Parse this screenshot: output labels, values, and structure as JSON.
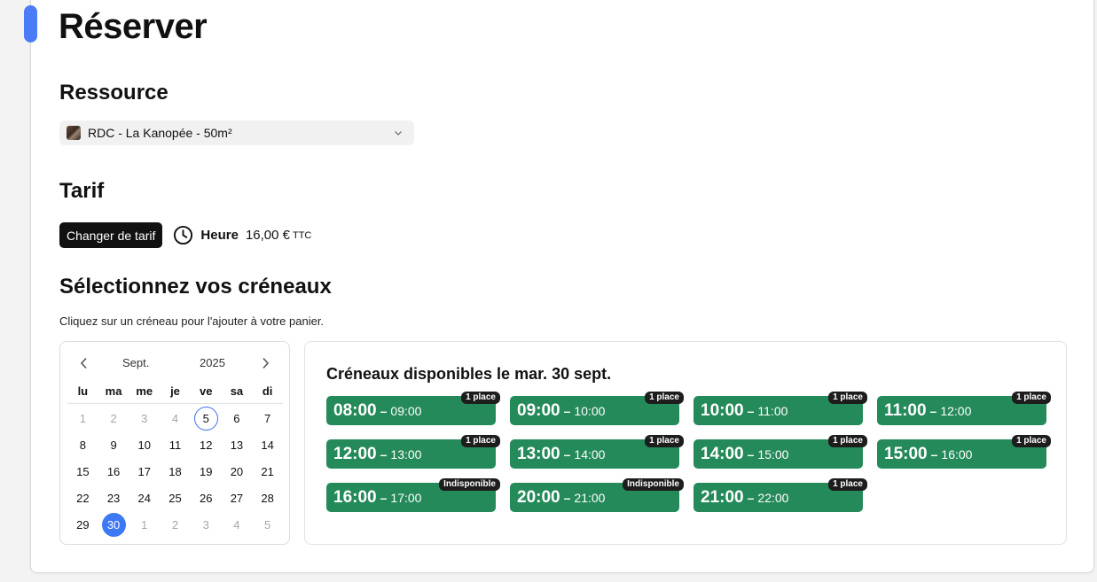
{
  "page": {
    "title": "Réserver"
  },
  "resource": {
    "heading": "Ressource",
    "selected": "RDC - La Kanopée - 50m²"
  },
  "tarif": {
    "heading": "Tarif",
    "change_button": "Changer de tarif",
    "rate_label": "Heure",
    "price": "16,00 €",
    "tax_suffix": "TTC"
  },
  "slots_section": {
    "heading": "Sélectionnez vos créneaux",
    "hint": "Cliquez sur un créneau pour l'ajouter à votre panier."
  },
  "calendar": {
    "month": "Sept.",
    "year": "2025",
    "weekdays": [
      "lu",
      "ma",
      "me",
      "je",
      "ve",
      "sa",
      "di"
    ],
    "days": [
      {
        "d": "1",
        "state": "muted"
      },
      {
        "d": "2",
        "state": "muted"
      },
      {
        "d": "3",
        "state": "muted"
      },
      {
        "d": "4",
        "state": "muted"
      },
      {
        "d": "5",
        "state": "today"
      },
      {
        "d": "6",
        "state": ""
      },
      {
        "d": "7",
        "state": ""
      },
      {
        "d": "8",
        "state": ""
      },
      {
        "d": "9",
        "state": ""
      },
      {
        "d": "10",
        "state": ""
      },
      {
        "d": "11",
        "state": ""
      },
      {
        "d": "12",
        "state": ""
      },
      {
        "d": "13",
        "state": ""
      },
      {
        "d": "14",
        "state": ""
      },
      {
        "d": "15",
        "state": ""
      },
      {
        "d": "16",
        "state": ""
      },
      {
        "d": "17",
        "state": ""
      },
      {
        "d": "18",
        "state": ""
      },
      {
        "d": "19",
        "state": ""
      },
      {
        "d": "20",
        "state": ""
      },
      {
        "d": "21",
        "state": ""
      },
      {
        "d": "22",
        "state": ""
      },
      {
        "d": "23",
        "state": ""
      },
      {
        "d": "24",
        "state": ""
      },
      {
        "d": "25",
        "state": ""
      },
      {
        "d": "26",
        "state": ""
      },
      {
        "d": "27",
        "state": ""
      },
      {
        "d": "28",
        "state": ""
      },
      {
        "d": "29",
        "state": ""
      },
      {
        "d": "30",
        "state": "selected"
      },
      {
        "d": "1",
        "state": "muted"
      },
      {
        "d": "2",
        "state": "muted"
      },
      {
        "d": "3",
        "state": "muted"
      },
      {
        "d": "4",
        "state": "muted"
      },
      {
        "d": "5",
        "state": "muted"
      }
    ]
  },
  "slots": {
    "title": "Créneaux disponibles le mar. 30 sept.",
    "items": [
      {
        "start": "08:00",
        "end": "09:00",
        "badge": "1 place"
      },
      {
        "start": "09:00",
        "end": "10:00",
        "badge": "1 place"
      },
      {
        "start": "10:00",
        "end": "11:00",
        "badge": "1 place"
      },
      {
        "start": "11:00",
        "end": "12:00",
        "badge": "1 place"
      },
      {
        "start": "12:00",
        "end": "13:00",
        "badge": "1 place"
      },
      {
        "start": "13:00",
        "end": "14:00",
        "badge": "1 place"
      },
      {
        "start": "14:00",
        "end": "15:00",
        "badge": "1 place"
      },
      {
        "start": "15:00",
        "end": "16:00",
        "badge": "1 place"
      },
      {
        "start": "16:00",
        "end": "17:00",
        "badge": "Indisponible"
      },
      {
        "start": "20:00",
        "end": "21:00",
        "badge": "Indisponible"
      },
      {
        "start": "21:00",
        "end": "22:00",
        "badge": "1 place"
      }
    ]
  },
  "colors": {
    "accent": "#4a7cf6",
    "slot_green": "#258a5a",
    "selected_day": "#3d78f5",
    "badge_bg": "#1d1d1d"
  }
}
